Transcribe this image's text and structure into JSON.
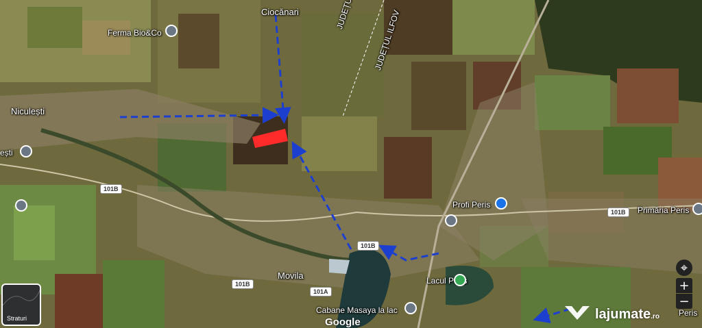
{
  "places": {
    "ciocanari": "Ciocănari",
    "ferma": "Ferma Bio&Co",
    "niculesti": "Niculești",
    "esti": "ești",
    "judet_dambovita": "JUDEȚUL DÂMBOVIȚA",
    "judet_ilfov": "JUDEȚUL ILFOV",
    "profi": "Profi Peris",
    "primaria": "Primăria Peris",
    "movila": "Movila",
    "lacul": "Lacul Peris",
    "cabane": "Cabane Masaya la lac",
    "peris_partial": "Peris"
  },
  "roads": {
    "r1": "101B",
    "r2": "101B",
    "r3": "101B",
    "r4": "101B",
    "r5": "101A"
  },
  "controls": {
    "locate": "⌖",
    "zoom_in": "+",
    "zoom_out": "−",
    "layers_label": "Straturi"
  },
  "attribution": "Google",
  "watermark": {
    "brand": "lajumate",
    "tld": ".ro"
  },
  "colors": {
    "arrow": "#1c3fd0",
    "parcel": "#ff2a2a",
    "pin_blue": "#1a73e8",
    "pin_green": "#34a853"
  }
}
